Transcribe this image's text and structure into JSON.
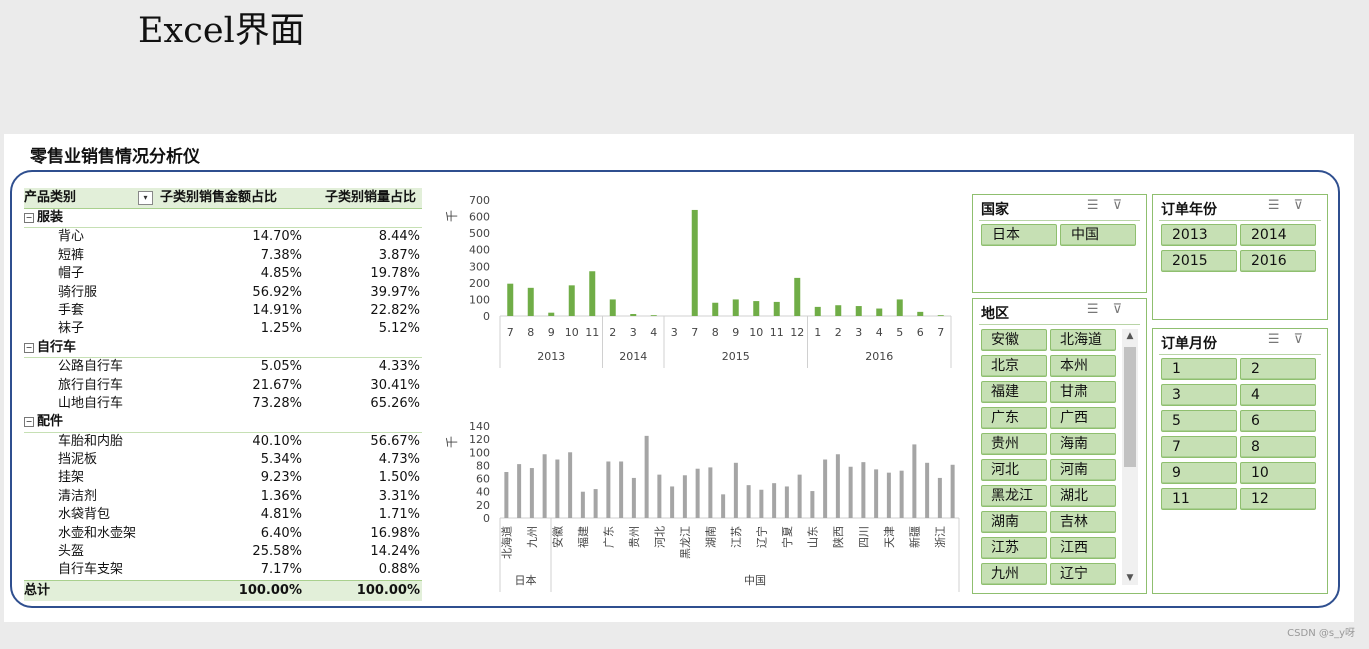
{
  "page_title": "Excel界面",
  "dashboard_title": "零售业销售情况分析仪",
  "pivot": {
    "headers": [
      "产品类别",
      "子类别销售金额占比",
      "子类别销量占比"
    ],
    "categories": [
      {
        "name": "服装",
        "items": [
          {
            "label": "背心",
            "amount": "14.70%",
            "qty": "8.44%"
          },
          {
            "label": "短裤",
            "amount": "7.38%",
            "qty": "3.87%"
          },
          {
            "label": "帽子",
            "amount": "4.85%",
            "qty": "19.78%"
          },
          {
            "label": "骑行服",
            "amount": "56.92%",
            "qty": "39.97%"
          },
          {
            "label": "手套",
            "amount": "14.91%",
            "qty": "22.82%"
          },
          {
            "label": "袜子",
            "amount": "1.25%",
            "qty": "5.12%"
          }
        ]
      },
      {
        "name": "自行车",
        "items": [
          {
            "label": "公路自行车",
            "amount": "5.05%",
            "qty": "4.33%"
          },
          {
            "label": "旅行自行车",
            "amount": "21.67%",
            "qty": "30.41%"
          },
          {
            "label": "山地自行车",
            "amount": "73.28%",
            "qty": "65.26%"
          }
        ]
      },
      {
        "name": "配件",
        "items": [
          {
            "label": "车胎和内胎",
            "amount": "40.10%",
            "qty": "56.67%"
          },
          {
            "label": "挡泥板",
            "amount": "5.34%",
            "qty": "4.73%"
          },
          {
            "label": "挂架",
            "amount": "9.23%",
            "qty": "1.50%"
          },
          {
            "label": "清洁剂",
            "amount": "1.36%",
            "qty": "3.31%"
          },
          {
            "label": "水袋背包",
            "amount": "4.81%",
            "qty": "1.71%"
          },
          {
            "label": "水壶和水壶架",
            "amount": "6.40%",
            "qty": "16.98%"
          },
          {
            "label": "头盔",
            "amount": "25.58%",
            "qty": "14.24%"
          },
          {
            "label": "自行车支架",
            "amount": "7.17%",
            "qty": "0.88%"
          }
        ]
      }
    ],
    "total": {
      "label": "总计",
      "amount": "100.00%",
      "qty": "100.00%"
    }
  },
  "chart_data": [
    {
      "type": "bar",
      "ylabel": "千",
      "ylim": [
        0,
        700
      ],
      "yticks": [
        0,
        100,
        200,
        300,
        400,
        500,
        600,
        700
      ],
      "color": "#70ad47",
      "groups": [
        {
          "label": "2013",
          "categories": [
            "7",
            "8",
            "9",
            "10",
            "11"
          ],
          "values": [
            195,
            170,
            20,
            185,
            270
          ]
        },
        {
          "label": "2014",
          "categories": [
            "2",
            "3",
            "4"
          ],
          "values": [
            100,
            12,
            5
          ]
        },
        {
          "label": "2015",
          "categories": [
            "3",
            "7",
            "8",
            "9",
            "10",
            "11",
            "12"
          ],
          "values": [
            0,
            640,
            80,
            100,
            90,
            85,
            230
          ]
        },
        {
          "label": "2016",
          "categories": [
            "1",
            "2",
            "3",
            "4",
            "5",
            "6",
            "7"
          ],
          "values": [
            55,
            65,
            60,
            45,
            100,
            25,
            5
          ]
        }
      ]
    },
    {
      "type": "bar",
      "ylabel": "千",
      "ylim": [
        0,
        140
      ],
      "yticks": [
        0,
        20,
        40,
        60,
        80,
        100,
        120,
        140
      ],
      "color": "#a5a5a5",
      "groups": [
        {
          "label": "日本",
          "categories": [
            "北海道",
            "",
            "九州",
            ""
          ],
          "values": [
            70,
            82,
            76,
            97
          ]
        },
        {
          "label": "中国",
          "categories": [
            "安徽",
            "",
            "福建",
            "",
            "广东",
            "",
            "贵州",
            "",
            "河北",
            "",
            "黑龙江",
            "",
            "湖南",
            "",
            "江苏",
            "",
            "辽宁",
            "",
            "宁夏",
            "",
            "山东",
            "",
            "陕西",
            "",
            "四川",
            "",
            "天津",
            "",
            "新疆",
            "",
            "浙江",
            ""
          ],
          "values": [
            89,
            100,
            40,
            44,
            86,
            86,
            61,
            125,
            66,
            48,
            65,
            75,
            77,
            36,
            84,
            50,
            43,
            53,
            48,
            66,
            41,
            89,
            97,
            78,
            85,
            74,
            69,
            72,
            112,
            84,
            61,
            81
          ]
        }
      ]
    }
  ],
  "slicers": {
    "country": {
      "title": "国家",
      "options": [
        "日本",
        "中国"
      ]
    },
    "region": {
      "title": "地区",
      "options": [
        "安徽",
        "北海道",
        "北京",
        "本州",
        "福建",
        "甘肃",
        "广东",
        "广西",
        "贵州",
        "海南",
        "河北",
        "河南",
        "黑龙江",
        "湖北",
        "湖南",
        "吉林",
        "江苏",
        "江西",
        "九州",
        "辽宁"
      ]
    },
    "year": {
      "title": "订单年份",
      "options": [
        "2013",
        "2014",
        "2015",
        "2016"
      ]
    },
    "month": {
      "title": "订单月份",
      "options": [
        "1",
        "2",
        "3",
        "4",
        "5",
        "6",
        "7",
        "8",
        "9",
        "10",
        "11",
        "12"
      ]
    },
    "icons": [
      "multi-select-icon",
      "clear-filter-icon"
    ]
  },
  "watermark": "CSDN @s_y呀"
}
